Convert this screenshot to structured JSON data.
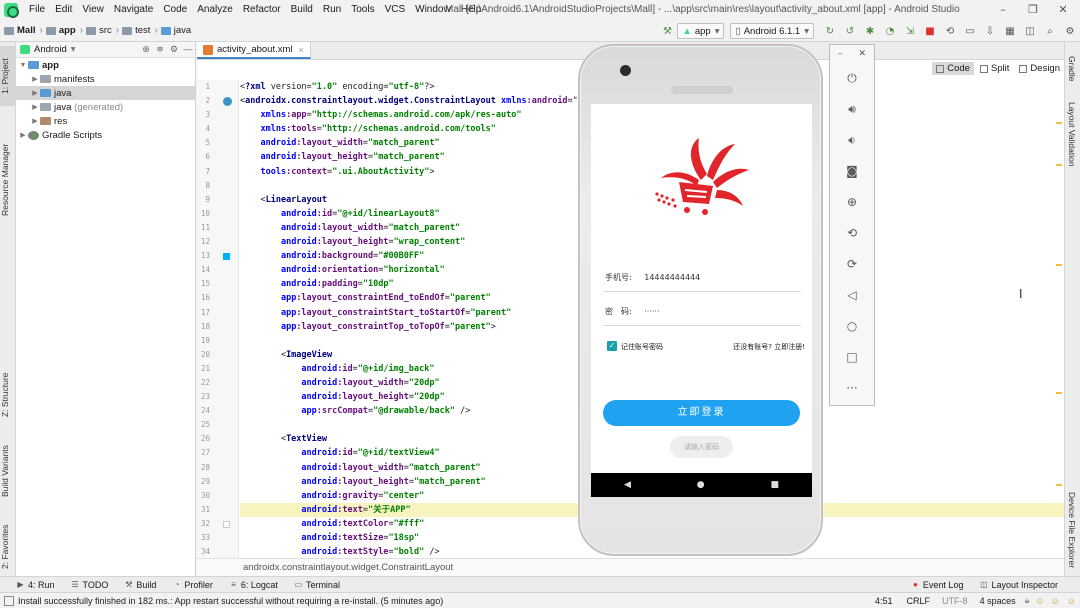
{
  "menu": [
    "File",
    "Edit",
    "View",
    "Navigate",
    "Code",
    "Analyze",
    "Refactor",
    "Build",
    "Run",
    "Tools",
    "VCS",
    "Window",
    "Help"
  ],
  "window_title": "Mall [E:\\Android6.1\\AndroidStudioProjects\\Mall] - ...\\app\\src\\main\\res\\layout\\activity_about.xml [app] - Android Studio",
  "breadcrumb": [
    "Mall",
    "app",
    "src",
    "test",
    "java"
  ],
  "run_config": "app",
  "device": "Android 6.1.1",
  "left_tabs": [
    "1: Project",
    "Resource Manager",
    "Z: Structure",
    "Build Variants",
    "2: Favorites"
  ],
  "project_panel": {
    "view_mode": "Android",
    "tree": [
      {
        "label": "app",
        "level": 0,
        "expanded": true
      },
      {
        "label": "manifests",
        "level": 1
      },
      {
        "label": "java",
        "level": 1,
        "selected": true
      },
      {
        "label": "java",
        "suffix": "(generated)",
        "level": 1
      },
      {
        "label": "res",
        "level": 1
      },
      {
        "label": "Gradle Scripts",
        "level": 0
      }
    ]
  },
  "editor": {
    "tab": "activity_about.xml",
    "views": [
      "Code",
      "Split",
      "Design"
    ],
    "active_view": "Code",
    "footer": "androidx.constraintlayout.widget.ConstraintLayout",
    "line_numbers": [
      "1",
      "2",
      "3",
      "4",
      "5",
      "6",
      "7",
      "8",
      "9",
      "10",
      "11",
      "12",
      "13",
      "14",
      "15",
      "16",
      "17",
      "18",
      "19",
      "20",
      "21",
      "22",
      "23",
      "24",
      "25",
      "26",
      "27",
      "28",
      "29",
      "30",
      "31",
      "32",
      "33",
      "34"
    ],
    "lines": [
      "<?xml version=\"1.0\" encoding=\"utf-8\"?>",
      "<androidx.constraintlayout.widget.ConstraintLayout xmlns:android=\"",
      "    xmlns:app=\"http://schemas.android.com/apk/res-auto\"",
      "    xmlns:tools=\"http://schemas.android.com/tools\"",
      "    android:layout_width=\"match_parent\"",
      "    android:layout_height=\"match_parent\"",
      "    tools:context=\".ui.AboutActivity\">",
      "",
      "    <LinearLayout",
      "        android:id=\"@+id/linearLayout8\"",
      "        android:layout_width=\"match_parent\"",
      "        android:layout_height=\"wrap_content\"",
      "        android:background=\"#00B0FF\"",
      "        android:orientation=\"horizontal\"",
      "        android:padding=\"10dp\"",
      "        app:layout_constraintEnd_toEndOf=\"parent\"",
      "        app:layout_constraintStart_toStartOf=\"parent\"",
      "        app:layout_constraintTop_toTopOf=\"parent\">",
      "",
      "        <ImageView",
      "            android:id=\"@+id/img_back\"",
      "            android:layout_width=\"20dp\"",
      "            android:layout_height=\"20dp\"",
      "            app:srcCompat=\"@drawable/back\" />",
      "",
      "        <TextView",
      "            android:id=\"@+id/textView4\"",
      "            android:layout_width=\"match_parent\"",
      "            android:layout_height=\"match_parent\"",
      "            android:gravity=\"center\"",
      "            android:text=\"关于APP\"",
      "            android:textColor=\"#fff\"",
      "            android:textSize=\"18sp\"",
      "            android:textStyle=\"bold\" />"
    ]
  },
  "right_tabs": [
    "Gradle",
    "Layout Validation",
    "Device File Explorer"
  ],
  "bottom_tools": [
    "4: Run",
    "TODO",
    "Build",
    "Profiler",
    "6: Logcat",
    "Terminal"
  ],
  "bottom_right_tools": [
    "Event Log",
    "Layout Inspector"
  ],
  "status": {
    "message": "Install successfully finished in 182 ms.: App restart successful without requiring a re-install. (5 minutes ago)",
    "position": "4:51",
    "line_sep": "CRLF",
    "encoding": "UTF-8",
    "indent": "4 spaces"
  },
  "emulator": {
    "phone_label": "手机号:",
    "phone_value": "14444444444",
    "password_label": "密　码:",
    "password_value": "······",
    "remember_label": "记住账号密码",
    "register_link": "还没有账号? 立即注册!",
    "login_button": "立即登录",
    "toast": "请输入密码",
    "controls": [
      "power",
      "volume-up",
      "volume-down",
      "camera",
      "zoom-in",
      "rotate-left",
      "rotate-right",
      "back",
      "home",
      "overview",
      "more"
    ]
  },
  "colors": {
    "login_button": "#1fa3f0",
    "checkbox": "#1aa0a8",
    "logo_red": "#e0262b"
  }
}
